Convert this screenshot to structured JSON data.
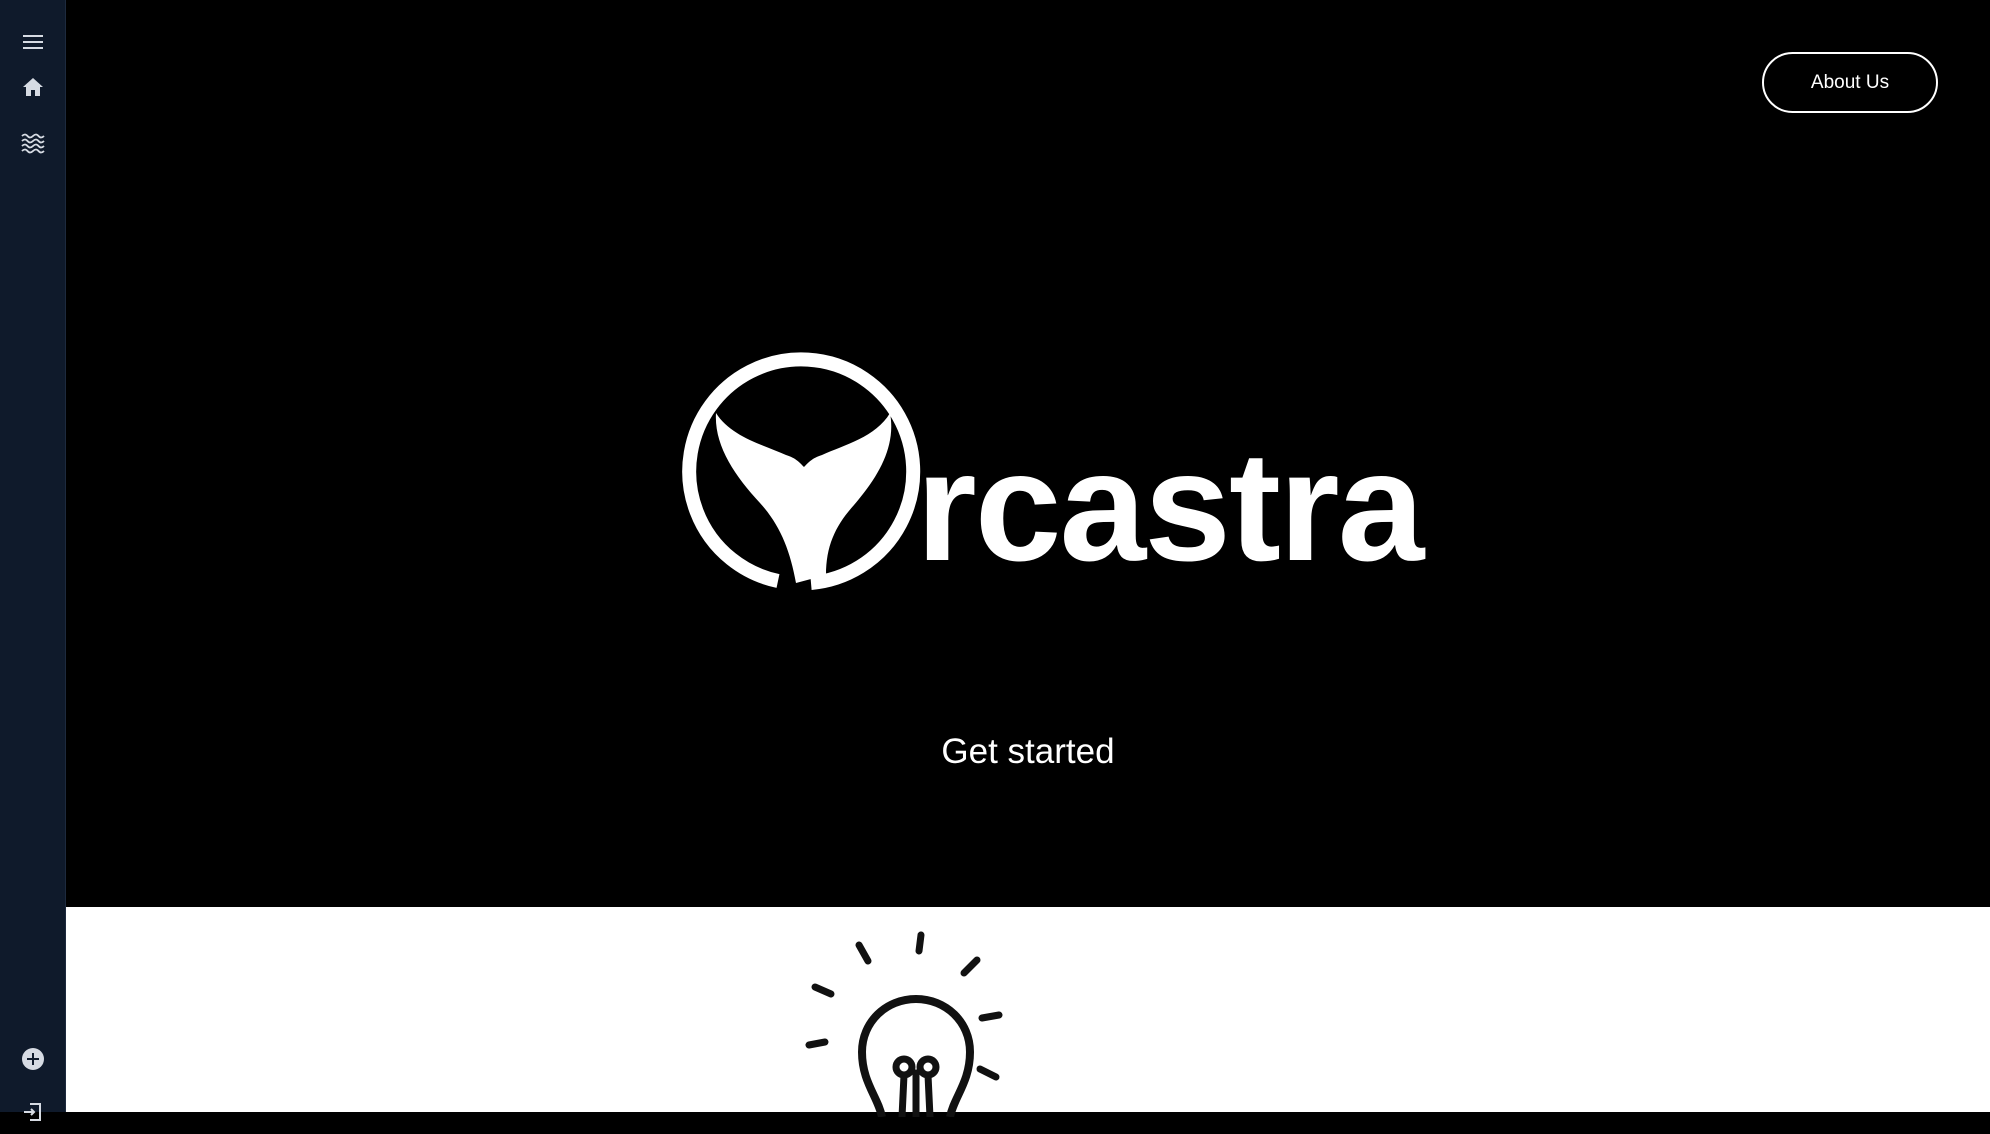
{
  "header": {
    "about_label": "About Us"
  },
  "brand": {
    "logo_text": "rcastra",
    "logo_icon": "whale-tail-in-circle"
  },
  "hero": {
    "cta_label": "Get started"
  },
  "sidebar": {
    "items": [
      {
        "name": "menu",
        "icon": "hamburger-icon"
      },
      {
        "name": "home",
        "icon": "home-icon"
      },
      {
        "name": "waves",
        "icon": "waves-icon"
      },
      {
        "name": "add",
        "icon": "plus-circle-icon"
      },
      {
        "name": "logout",
        "icon": "logout-icon"
      }
    ]
  },
  "features": {
    "icon": "lightbulb-icon"
  },
  "colors": {
    "sidebar_bg": "#0f1a2b",
    "hero_bg": "#000000",
    "text": "#ffffff",
    "lower_bg": "#ffffff"
  }
}
